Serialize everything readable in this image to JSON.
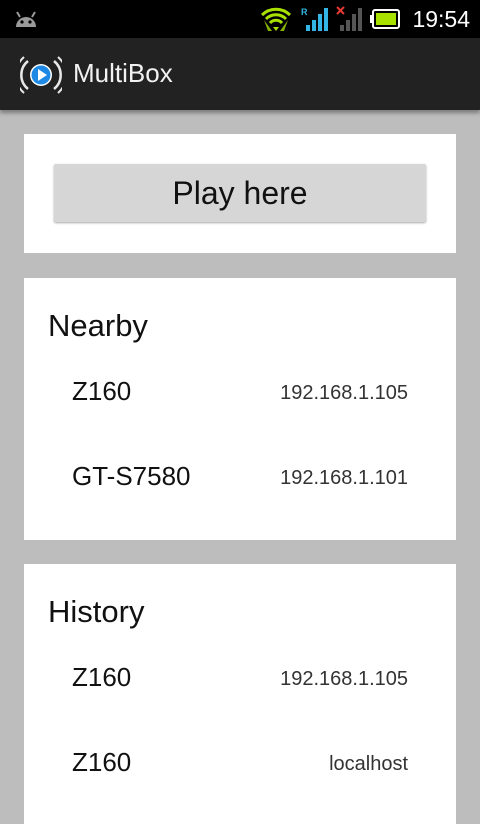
{
  "status_bar": {
    "time": "19:54",
    "icons": [
      "android-debug-icon",
      "wifi-icon",
      "roaming-signal-icon",
      "no-signal-icon",
      "battery-icon"
    ],
    "roaming_letter": "R",
    "battery_color": "#a8e000",
    "wifi_color": "#a8e000",
    "signal_color": "#33b5e5"
  },
  "app_bar": {
    "title": "MultiBox",
    "logo": "multibox-logo-icon"
  },
  "play": {
    "label": "Play here"
  },
  "nearby": {
    "title": "Nearby",
    "devices": [
      {
        "name": "Z160",
        "address": "192.168.1.105"
      },
      {
        "name": "GT-S7580",
        "address": "192.168.1.101"
      }
    ]
  },
  "history": {
    "title": "History",
    "devices": [
      {
        "name": "Z160",
        "address": "192.168.1.105"
      },
      {
        "name": "Z160",
        "address": "localhost"
      }
    ]
  }
}
